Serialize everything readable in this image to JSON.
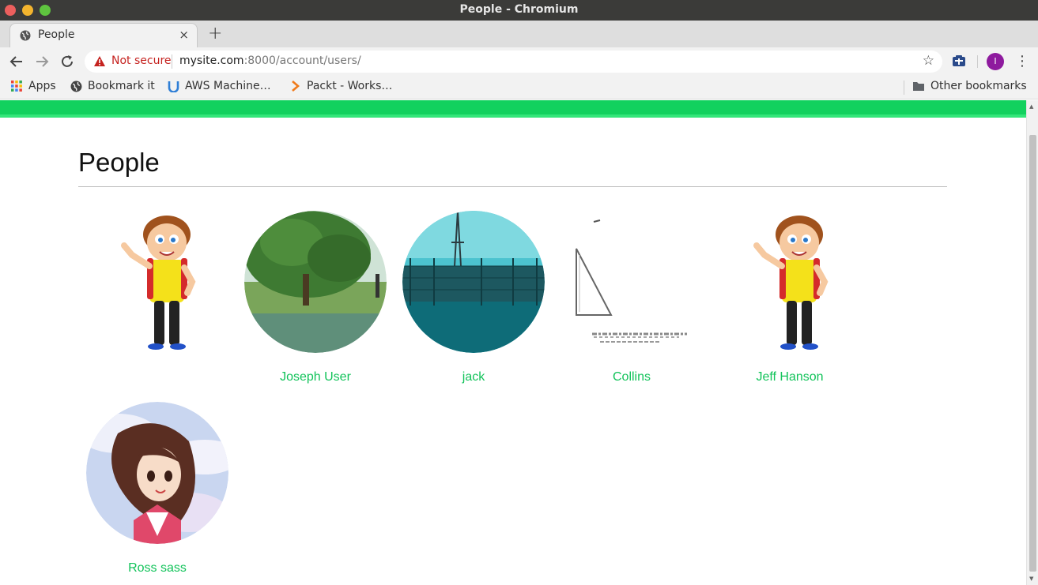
{
  "window": {
    "title": "People - Chromium"
  },
  "tab": {
    "title": "People",
    "close": "×",
    "new_tab": "+"
  },
  "toolbar": {
    "security_label": "Not secure",
    "url_host": "mysite.com",
    "url_rest": ":8000/account/users/",
    "profile_initial": "I"
  },
  "bookmarks": {
    "apps": "Apps",
    "bookmark_it": "Bookmark it",
    "aws": "AWS Machine…",
    "packt": "Packt - Works…",
    "other": "Other bookmarks"
  },
  "page": {
    "heading": "People",
    "people": [
      {
        "name": "",
        "avatar": "cartoon-boy"
      },
      {
        "name": "Joseph User",
        "avatar": "tree-photo"
      },
      {
        "name": "jack",
        "avatar": "fence-photo"
      },
      {
        "name": "Collins",
        "avatar": "sketch-triangle"
      },
      {
        "name": "Jeff Hanson",
        "avatar": "cartoon-boy"
      },
      {
        "name": "Ross sass",
        "avatar": "anime-girl"
      }
    ]
  },
  "colors": {
    "accent_green": "#12d15e",
    "link_green": "#12c35a",
    "profile_purple": "#8e1a9e"
  }
}
